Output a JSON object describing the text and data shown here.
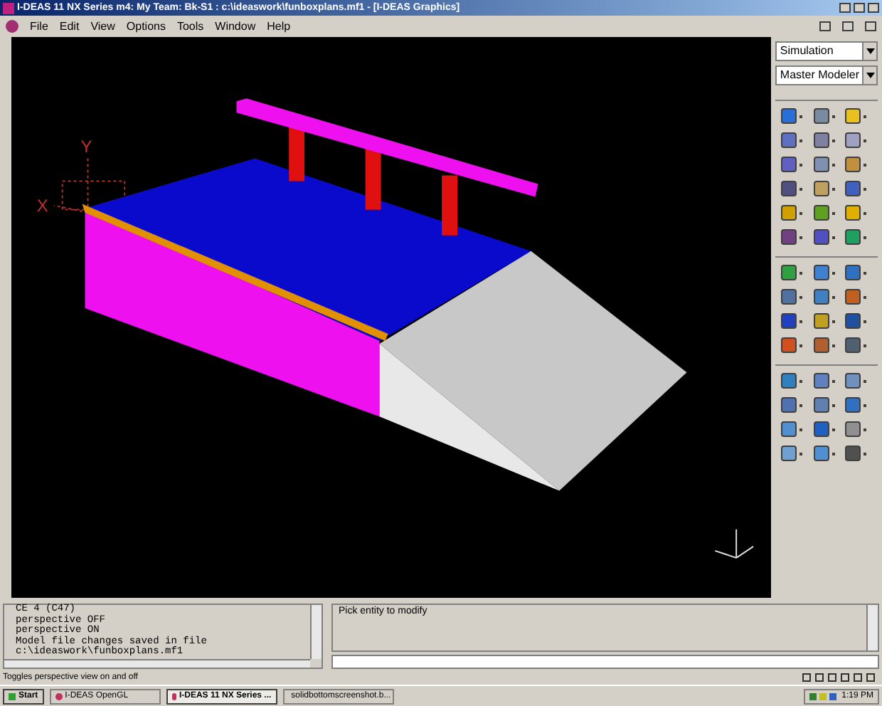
{
  "window": {
    "title": "I-DEAS 11 NX Series m4:   My Team: Bk-S1 : c:\\ideaswork\\funboxplans.mf1 - [I-DEAS Graphics]"
  },
  "menu": [
    "File",
    "Edit",
    "View",
    "Options",
    "Tools",
    "Window",
    "Help"
  ],
  "viewport": {
    "axis_labels": [
      {
        "kind": "y",
        "text": "Y"
      },
      {
        "kind": "x",
        "text": "X"
      }
    ]
  },
  "side_panel": {
    "task_select": "Simulation",
    "application_select": "Master Modeler"
  },
  "console": {
    "lines": [
      "CE 4 (C47)",
      "perspective OFF",
      "perspective ON",
      "Model file changes saved in file",
      "c:\\ideaswork\\funboxplans.mf1"
    ]
  },
  "prompt": {
    "text": "Pick entity to modify"
  },
  "status_bar": {
    "text": "Toggles perspective view on and off"
  },
  "taskbar": {
    "start": "Start",
    "items": [
      {
        "label": "I-DEAS OpenGL",
        "selected": false
      },
      {
        "label": "I-DEAS 11 NX Series ...",
        "selected": true
      },
      {
        "label": "solidbottomscreenshot.b...",
        "selected": false
      }
    ],
    "time": "1:19 PM"
  }
}
